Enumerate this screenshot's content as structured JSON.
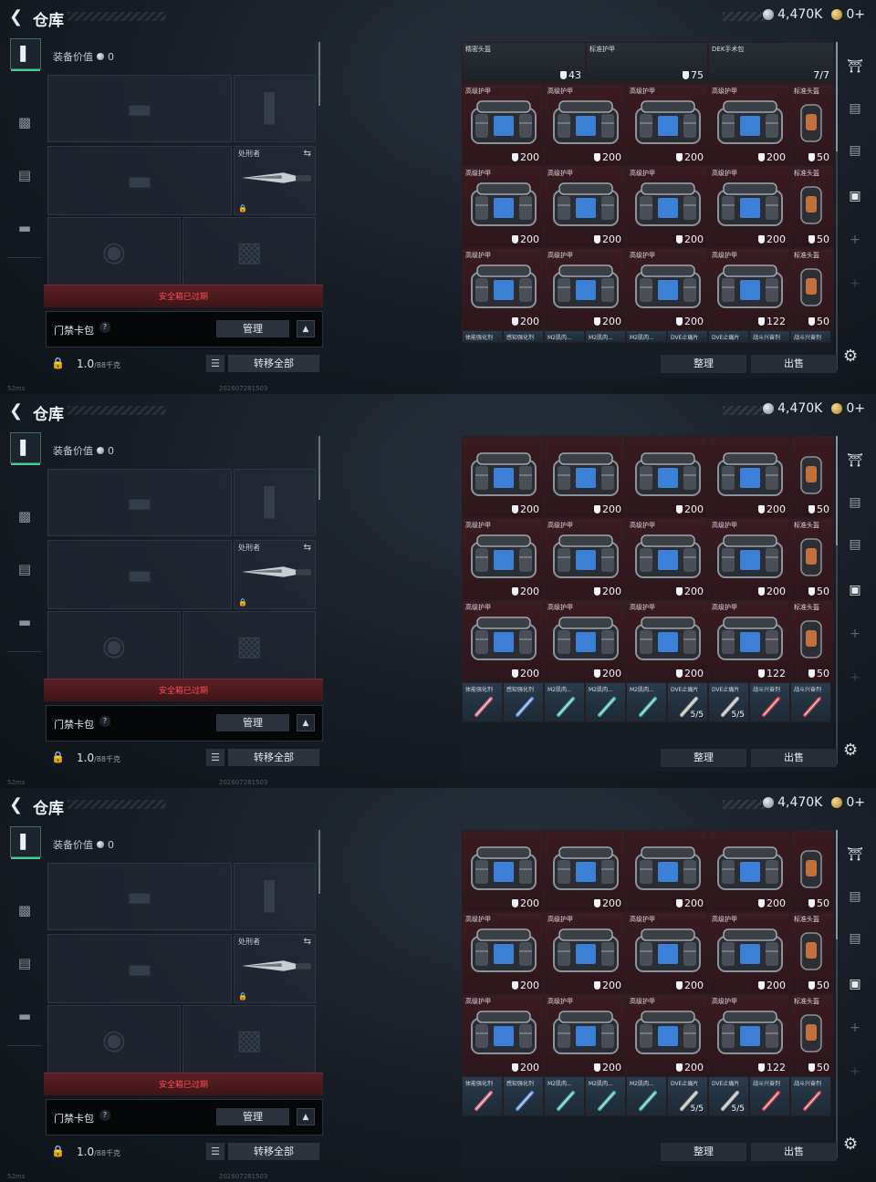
{
  "header": {
    "title": "仓库",
    "silver": "4,470K",
    "gold": "0+"
  },
  "equipment": {
    "value_label": "装备价值",
    "value": "0",
    "melee_label": "处刑者",
    "safebox_text": "安全箱已过期",
    "card_pack": "门禁卡包",
    "help": "?",
    "manage": "管理",
    "weight": "1.0",
    "weight_max": "/88千克",
    "transfer_all": "转移全部"
  },
  "inventory": {
    "top_row": [
      {
        "label": "精密头盔",
        "value": "43"
      },
      {
        "label": "标准护甲",
        "value": "75"
      },
      {
        "label": "DEK手术包",
        "value": "7/7"
      }
    ],
    "armor_label": "高级护甲",
    "helmet_label": "标准头盔",
    "rows": [
      [
        "200",
        "200",
        "200",
        "200",
        "50"
      ],
      [
        "200",
        "200",
        "200",
        "200",
        "50"
      ],
      [
        "200",
        "200",
        "200",
        "122",
        "50"
      ]
    ],
    "consumables": [
      {
        "label": "体能强化剂",
        "count": "",
        "color": "#d8677b"
      },
      {
        "label": "感知强化剂",
        "count": "",
        "color": "#5f8dd6"
      },
      {
        "label": "M2肌肉...",
        "count": "",
        "color": "#46b4a8"
      },
      {
        "label": "M2肌肉...",
        "count": "",
        "color": "#46b4a8"
      },
      {
        "label": "M2肌肉...",
        "count": "",
        "color": "#46b4a8"
      },
      {
        "label": "DVE止痛片",
        "count": "5/5",
        "color": "#b8b8b0"
      },
      {
        "label": "DVE止痛片",
        "count": "5/5",
        "color": "#b8b8b0"
      },
      {
        "label": "战斗兴奋剂",
        "count": "",
        "color": "#d34b52"
      },
      {
        "label": "战斗兴奋剂",
        "count": "",
        "color": "#d34b52"
      }
    ],
    "sort": "整理",
    "sell": "出售"
  },
  "footer": {
    "ping": "52ms",
    "build": "202607281503"
  },
  "colors": {
    "accent_green": "#37d49a",
    "danger_red": "#ff4d55",
    "armor_cell": "#3a1c22"
  }
}
